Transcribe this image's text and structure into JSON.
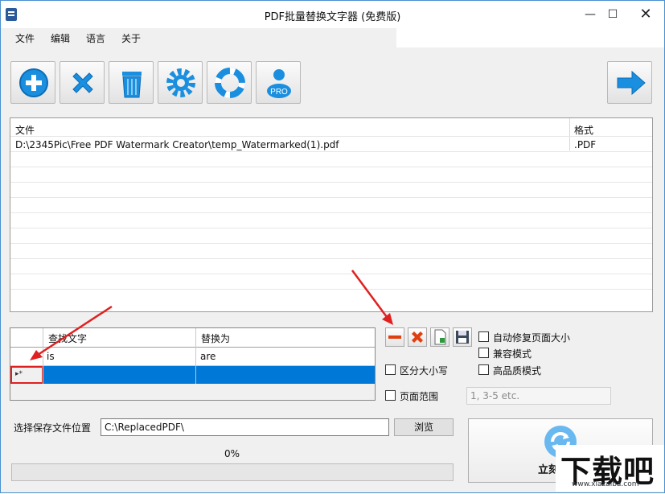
{
  "window": {
    "title": "PDF批量替换文字器 (免费版)",
    "minimize": "—",
    "maximize": "☐",
    "close": "✕"
  },
  "menu": [
    "文件",
    "编辑",
    "语言",
    "关于"
  ],
  "toolbar": {
    "icons": [
      "add-icon",
      "remove-icon",
      "trash-icon",
      "settings-icon",
      "help-lifebuoy-icon",
      "pro-user-icon",
      "next-arrow-icon"
    ],
    "pro_label": "PRO"
  },
  "files": {
    "columns": [
      "文件",
      "格式"
    ],
    "rows": [
      {
        "file": "D:\\2345Pic\\Free PDF Watermark Creator\\temp_Watermarked(1).pdf",
        "format": ".PDF"
      }
    ]
  },
  "search": {
    "columns": [
      "查找文字",
      "替换为"
    ],
    "rows": [
      {
        "find": "is",
        "replace": "are"
      }
    ],
    "new_row_marker": "▸*"
  },
  "options": {
    "auto_fix": "自动修复页面大小",
    "compat": "兼容模式",
    "case": "区分大小写",
    "hq": "高品质模式",
    "page_range": "页面范围",
    "page_range_placeholder": "1, 3-5 etc."
  },
  "save": {
    "label": "选择保存文件位置",
    "path": "C:\\ReplacedPDF\\",
    "browse": "浏览"
  },
  "progress": {
    "percent_text": "0%",
    "value": 0
  },
  "start": {
    "label": "立刻"
  },
  "watermark": {
    "main": "下载吧",
    "sub": "www.xiazaiba.com"
  },
  "colors": {
    "selection": "#0078d7",
    "toolbar_blue": "#1a8fe0",
    "annotation_red": "#e02020"
  }
}
